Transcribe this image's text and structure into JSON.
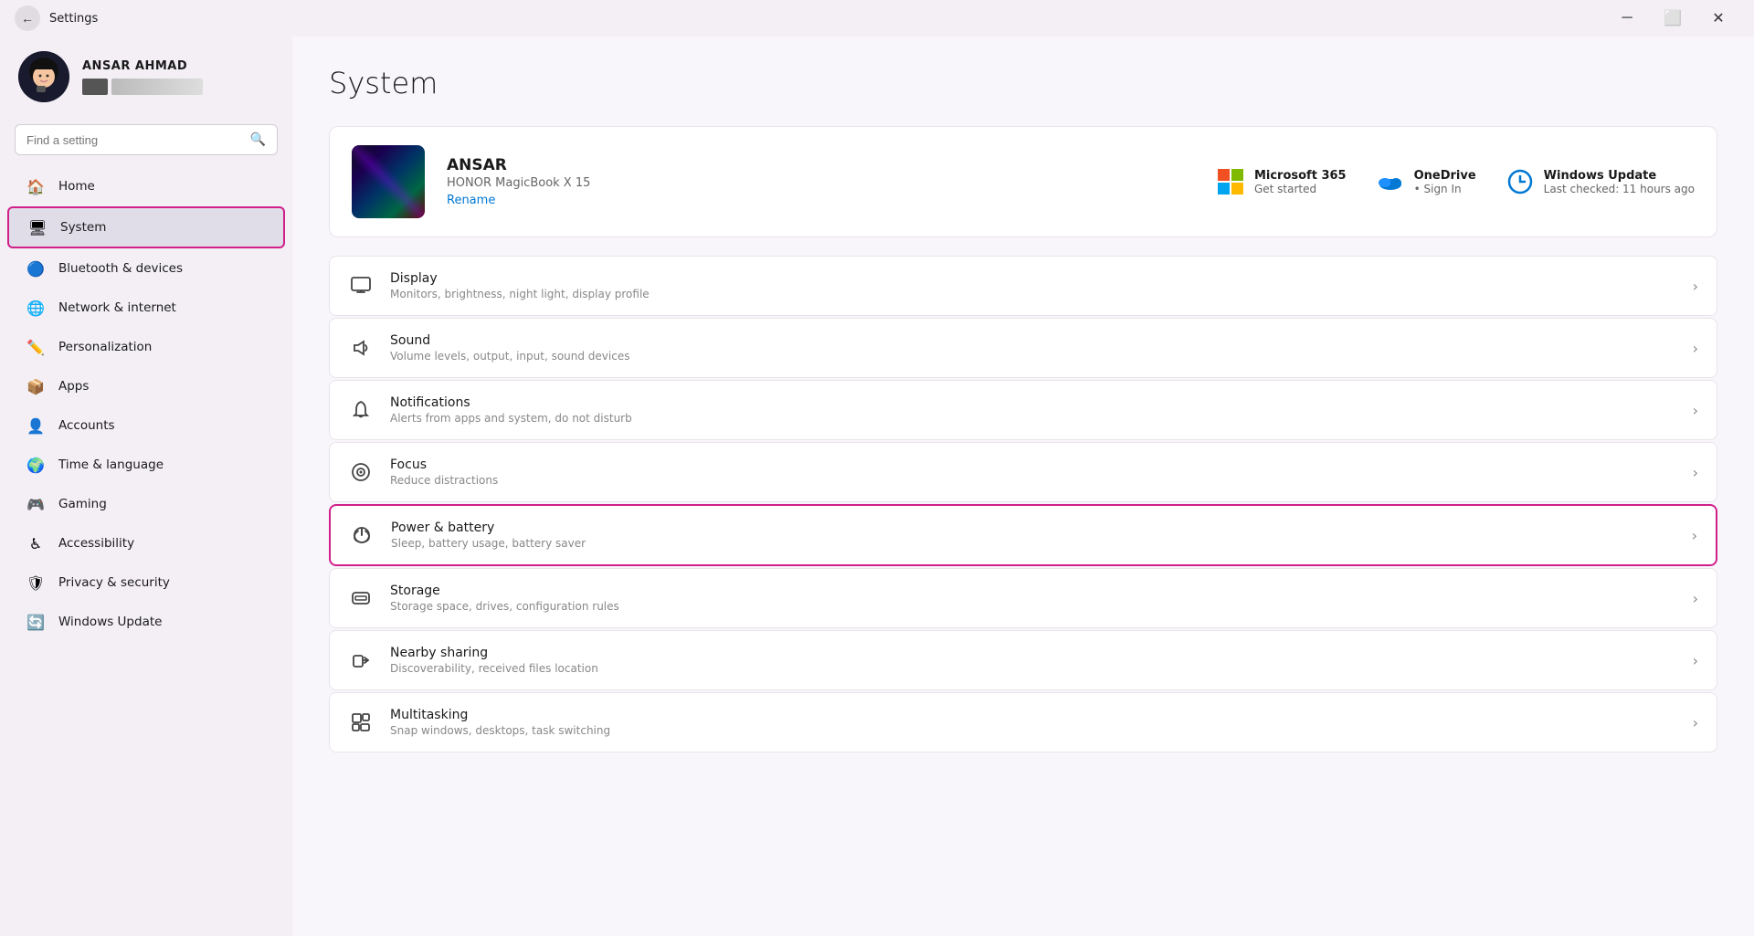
{
  "window": {
    "title": "Settings",
    "minimize_label": "─",
    "maximize_label": "⬜",
    "close_label": "✕"
  },
  "sidebar": {
    "search_placeholder": "Find a setting",
    "user": {
      "name": "ANSAR AHMAD"
    },
    "nav_items": [
      {
        "id": "home",
        "label": "Home",
        "icon": "🏠",
        "active": false
      },
      {
        "id": "system",
        "label": "System",
        "icon": "🖥",
        "active": true
      },
      {
        "id": "bluetooth",
        "label": "Bluetooth & devices",
        "icon": "🔵",
        "active": false
      },
      {
        "id": "network",
        "label": "Network & internet",
        "icon": "🌐",
        "active": false
      },
      {
        "id": "personalization",
        "label": "Personalization",
        "icon": "✏️",
        "active": false
      },
      {
        "id": "apps",
        "label": "Apps",
        "icon": "📦",
        "active": false
      },
      {
        "id": "accounts",
        "label": "Accounts",
        "icon": "👤",
        "active": false
      },
      {
        "id": "time",
        "label": "Time & language",
        "icon": "🌍",
        "active": false
      },
      {
        "id": "gaming",
        "label": "Gaming",
        "icon": "🎮",
        "active": false
      },
      {
        "id": "accessibility",
        "label": "Accessibility",
        "icon": "♿",
        "active": false
      },
      {
        "id": "privacy",
        "label": "Privacy & security",
        "icon": "🛡",
        "active": false
      },
      {
        "id": "update",
        "label": "Windows Update",
        "icon": "🔄",
        "active": false
      }
    ]
  },
  "main": {
    "page_title": "System",
    "device": {
      "name": "ANSAR",
      "model": "HONOR MagicBook X 15",
      "rename_label": "Rename"
    },
    "quick_links": [
      {
        "id": "microsoft365",
        "title": "Microsoft 365",
        "subtitle": "Get started",
        "icon_color": "#e74c3c"
      },
      {
        "id": "onedrive",
        "title": "OneDrive",
        "subtitle": "• Sign In",
        "icon_color": "#0078d4"
      },
      {
        "id": "windows_update",
        "title": "Windows Update",
        "subtitle": "Last checked: 11 hours ago",
        "icon_color": "#0078d4"
      }
    ],
    "settings": [
      {
        "id": "display",
        "title": "Display",
        "subtitle": "Monitors, brightness, night light, display profile",
        "icon": "🖥",
        "highlighted": false
      },
      {
        "id": "sound",
        "title": "Sound",
        "subtitle": "Volume levels, output, input, sound devices",
        "icon": "🔊",
        "highlighted": false
      },
      {
        "id": "notifications",
        "title": "Notifications",
        "subtitle": "Alerts from apps and system, do not disturb",
        "icon": "🔔",
        "highlighted": false
      },
      {
        "id": "focus",
        "title": "Focus",
        "subtitle": "Reduce distractions",
        "icon": "🎯",
        "highlighted": false
      },
      {
        "id": "power",
        "title": "Power & battery",
        "subtitle": "Sleep, battery usage, battery saver",
        "icon": "⏻",
        "highlighted": true
      },
      {
        "id": "storage",
        "title": "Storage",
        "subtitle": "Storage space, drives, configuration rules",
        "icon": "💾",
        "highlighted": false
      },
      {
        "id": "nearby",
        "title": "Nearby sharing",
        "subtitle": "Discoverability, received files location",
        "icon": "📤",
        "highlighted": false
      },
      {
        "id": "multitasking",
        "title": "Multitasking",
        "subtitle": "Snap windows, desktops, task switching",
        "icon": "⧉",
        "highlighted": false
      }
    ]
  }
}
